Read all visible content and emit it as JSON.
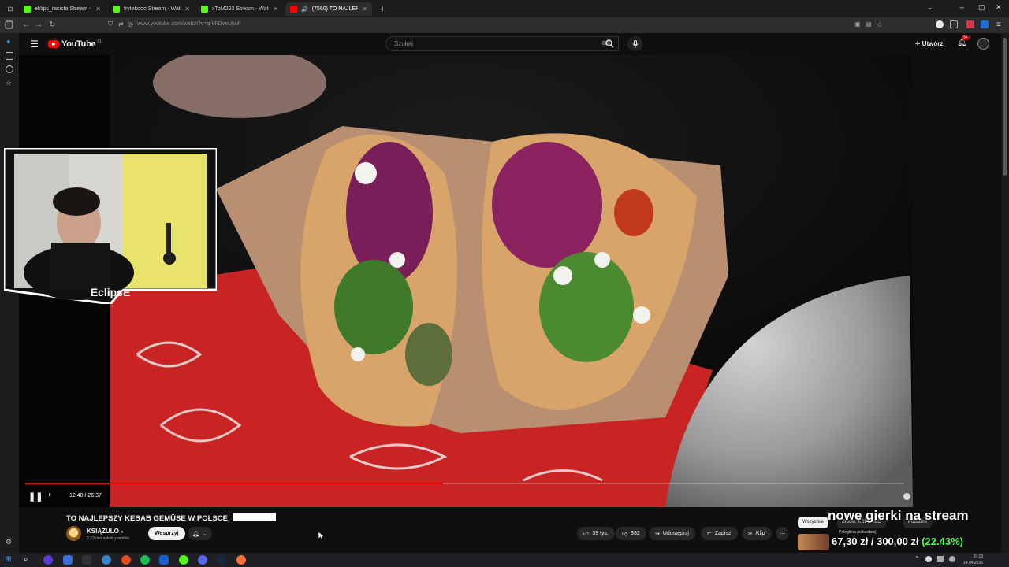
{
  "browser": {
    "tabs": [
      {
        "title": "eklips_rasista Stream - Kick Da",
        "color": "#53fc18",
        "active": false
      },
      {
        "title": "frytekooo Stream - Watch",
        "color": "#53fc18",
        "active": false
      },
      {
        "title": "xToM223 Stream - Watch",
        "color": "#53fc18",
        "active": false
      },
      {
        "title": "(7560) TO NAJLEPSZY KEBA",
        "color": "#ff0000",
        "active": true
      }
    ],
    "url": "www.youtube.com/watch?v=q-kFDveUpMI"
  },
  "youtube": {
    "logo_text": "YouTube",
    "logo_region": "PL",
    "search_placeholder": "Szukaj",
    "create_label": "Utwórz",
    "notification_count": "9+"
  },
  "player": {
    "current_time": "12:40",
    "duration": "26:37",
    "progress": 0.476
  },
  "webcam": {
    "name": "EclipsE"
  },
  "video": {
    "title": "TO NAJLEPSZY KEBAB GEMÜSE W POLSCE",
    "channel": "KSIĄŻULO",
    "subscribers": "2,23 mln subskrybentów",
    "support_label": "Wesprzyj",
    "likes": "39 tys.",
    "dislikes": "392",
    "share_label": "Udostępnij",
    "save_label": "Zapisz",
    "clip_label": "Klip"
  },
  "related_chips": [
    "Wszystkie",
    "Źródło: KSIĄŻULO",
    "Podobne"
  ],
  "stream_overlay": {
    "headline": "nowe gierki na stream",
    "goal_text": "67,30 zł / 300,00 zł",
    "goal_percent": "(22.43%)",
    "goal_progress": 0.2243,
    "goal_subtitle": "Polegli na polbardziej"
  },
  "taskbar": {
    "time": "20:13",
    "date": "14.04.2026"
  },
  "colors": {
    "yt_red": "#ff0000",
    "kick_green": "#53fc18",
    "background": "#0f0f0f"
  }
}
